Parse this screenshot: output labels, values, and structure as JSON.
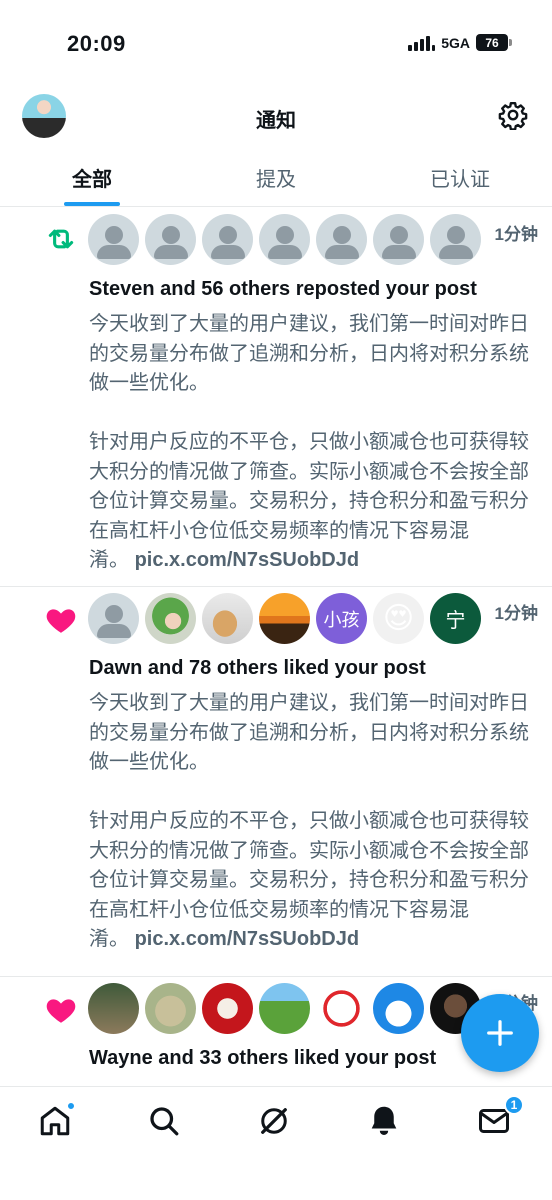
{
  "status_bar": {
    "time": "20:09",
    "network": "5GA",
    "battery": "76"
  },
  "header": {
    "title": "通知"
  },
  "tabs": [
    {
      "label": "全部",
      "active": true
    },
    {
      "label": "提及",
      "active": false
    },
    {
      "label": "已认证",
      "active": false
    }
  ],
  "notifications": [
    {
      "type": "repost",
      "time": "1分钟",
      "headline": "Steven and 56 others reposted your post",
      "paragraph1": "今天收到了大量的用户建议，我们第一时间对昨日的交易量分布做了追溯和分析，日内将对积分系统做一些优化。",
      "paragraph2": "针对用户反应的不平仓，只做小额减仓也可获得较大积分的情况做了筛查。实际小额减仓不会按全部仓位计算交易量。交易积分，持仓积分和盈亏积分在高杠杆小仓位低交易频率的情况下容易混淆。",
      "link": "pic.x.com/N7sSUobDJd"
    },
    {
      "type": "like",
      "time": "1分钟",
      "headline": "Dawn and 78 others liked your post",
      "avatar_texts": {
        "a5": "小孩",
        "a6": "😍",
        "a7": "宁"
      },
      "paragraph1": "今天收到了大量的用户建议，我们第一时间对昨日的交易量分布做了追溯和分析，日内将对积分系统做一些优化。",
      "paragraph2": "针对用户反应的不平仓，只做小额减仓也可获得较大积分的情况做了筛查。实际小额减仓不会按全部仓位计算交易量。交易积分，持仓积分和盈亏积分在高杠杆小仓位低交易频率的情况下容易混淆。",
      "link": "pic.x.com/N7sSUobDJd"
    },
    {
      "type": "like",
      "time": "1分钟",
      "headline": "Wayne and 33 others liked your post"
    }
  ],
  "bottom_nav": {
    "messages_badge": "1"
  },
  "colors": {
    "accent": "#1d9bf0",
    "repost": "#00ba7c",
    "like": "#f91880",
    "secondary_text": "#536471"
  },
  "icons": [
    "settings-icon",
    "repost-icon",
    "heart-icon",
    "home-icon",
    "search-icon",
    "grok-icon",
    "bell-icon",
    "mail-icon",
    "plus-icon"
  ]
}
